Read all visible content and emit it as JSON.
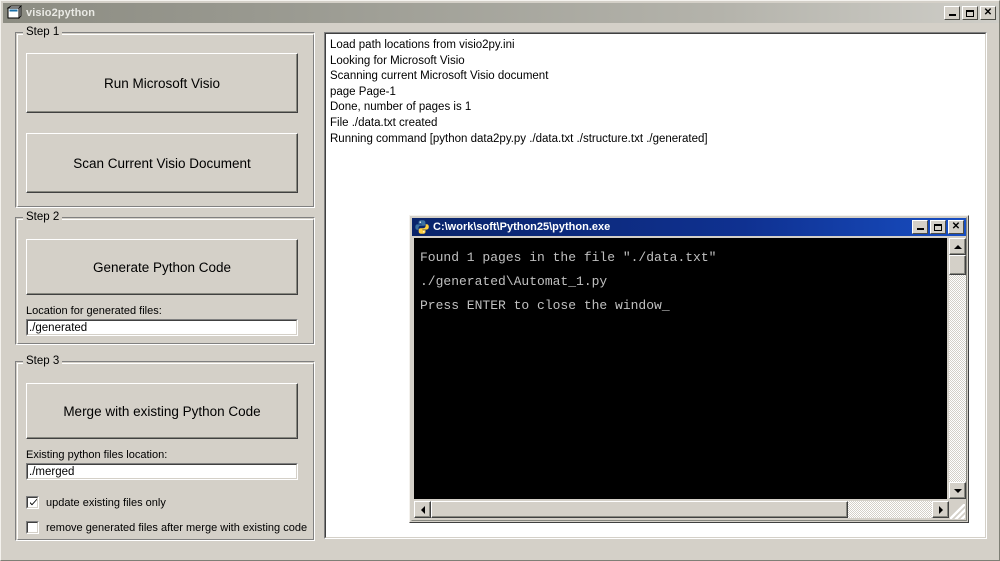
{
  "window": {
    "title": "visio2python",
    "icon": "app-window-icon",
    "controls": {
      "minimize": "Minimize",
      "maximize": "Maximize",
      "close": "Close"
    }
  },
  "step1": {
    "legend": "Step 1",
    "run_visio_button": "Run Microsoft Visio",
    "scan_document_button": "Scan Current Visio Document"
  },
  "step2": {
    "legend": "Step 2",
    "generate_button": "Generate Python Code",
    "location_label": "Location for generated files:",
    "location_value": "./generated",
    "location_placeholder": "./generated"
  },
  "step3": {
    "legend": "Step 3",
    "merge_button": "Merge with existing Python Code",
    "existing_label": "Existing python files location:",
    "existing_value": "./merged",
    "existing_placeholder": "./merged",
    "checkbox_update_label": "update existing files only",
    "checkbox_update_checked": true,
    "checkbox_remove_label": "remove generated files after merge with existing code",
    "checkbox_remove_checked": false
  },
  "log": {
    "lines": [
      "Load path locations from visio2py.ini",
      "Looking for Microsoft Visio",
      "Scanning current Microsoft Visio document",
      "page Page-1",
      "Done, number of pages is 1",
      "File  ./data.txt created",
      "Running command [python data2py.py ./data.txt ./structure.txt ./generated]"
    ]
  },
  "console": {
    "title": "C:\\work\\soft\\Python25\\python.exe",
    "icon": "python-icon",
    "controls": {
      "minimize": "Minimize",
      "maximize": "Maximize",
      "close": "Close"
    },
    "lines": [
      "Found 1 pages in the file \"./data.txt\"",
      "",
      "./generated\\Automat_1.py",
      "",
      "Press ENTER to close the window_"
    ],
    "scroll_up": "scroll-up",
    "scroll_down": "scroll-down",
    "scroll_left": "scroll-left",
    "scroll_right": "scroll-right"
  },
  "colors": {
    "face": "#d4d0c8",
    "console_bg": "#000000",
    "console_fg": "#c0c0c0",
    "active_title": "#0a246a",
    "inactive_title": "#8c8c82"
  }
}
